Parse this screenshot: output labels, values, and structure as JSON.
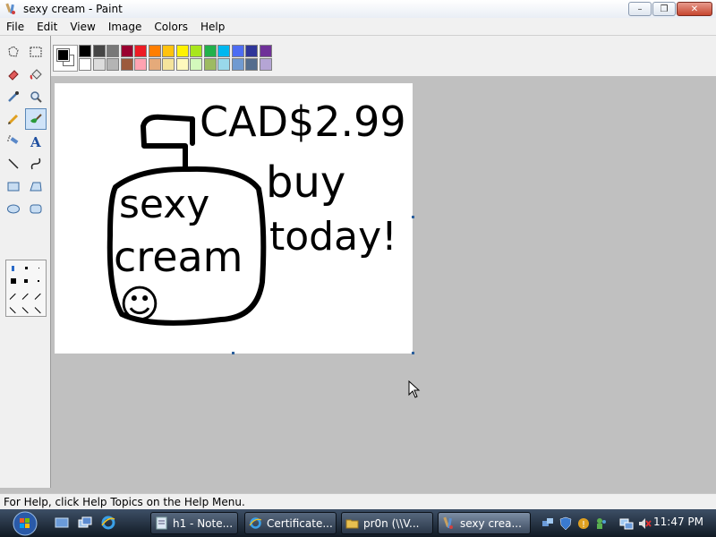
{
  "window": {
    "title": "sexy cream - Paint",
    "minimize": "–",
    "maximize": "❐",
    "close": "✕"
  },
  "menu": [
    "File",
    "Edit",
    "View",
    "Image",
    "Colors",
    "Help"
  ],
  "tools": [
    {
      "name": "free-select-icon"
    },
    {
      "name": "rect-select-icon"
    },
    {
      "name": "eraser-icon"
    },
    {
      "name": "fill-bucket-icon"
    },
    {
      "name": "color-picker-icon"
    },
    {
      "name": "magnifier-icon"
    },
    {
      "name": "pencil-icon"
    },
    {
      "name": "brush-icon",
      "active": true
    },
    {
      "name": "airbrush-icon"
    },
    {
      "name": "text-icon",
      "glyph": "A"
    },
    {
      "name": "line-icon"
    },
    {
      "name": "curve-icon"
    },
    {
      "name": "rectangle-icon"
    },
    {
      "name": "polygon-icon"
    },
    {
      "name": "ellipse-icon"
    },
    {
      "name": "rounded-rect-icon"
    }
  ],
  "palette": {
    "foreground": "#000000",
    "background": "#ffffff",
    "row1": [
      "#000000",
      "#464646",
      "#787878",
      "#990030",
      "#ed1c24",
      "#ff7e00",
      "#ffc20e",
      "#fff200",
      "#a8e61d",
      "#22b14c",
      "#00b7ef",
      "#4d6df3",
      "#2f3699",
      "#6f3198"
    ],
    "row2": [
      "#ffffff",
      "#dcdcdc",
      "#b4b4b4",
      "#9c5a3c",
      "#ffa3b1",
      "#e5aa7a",
      "#f5e49c",
      "#fff9bd",
      "#d3f9bc",
      "#9dbb61",
      "#99d9ea",
      "#709ad1",
      "#546d8e",
      "#b5a5d5"
    ]
  },
  "canvas_text": {
    "price": "CAD$2.99",
    "line2": "buy",
    "line3": "today!",
    "jar_line1": "sexy",
    "jar_line2": "cream",
    "smiley": "☺"
  },
  "status": "For Help, click Help Topics on the Help Menu.",
  "taskbar": {
    "buttons": [
      {
        "label": "h1 - Note...",
        "icon": "notepad-icon"
      },
      {
        "label": "Certificate...",
        "icon": "ie-icon"
      },
      {
        "label": "pr0n (\\\\V...",
        "icon": "folder-icon"
      },
      {
        "label": "sexy crea...",
        "icon": "paint-icon",
        "active": true
      }
    ],
    "clock": "11:47 PM"
  }
}
